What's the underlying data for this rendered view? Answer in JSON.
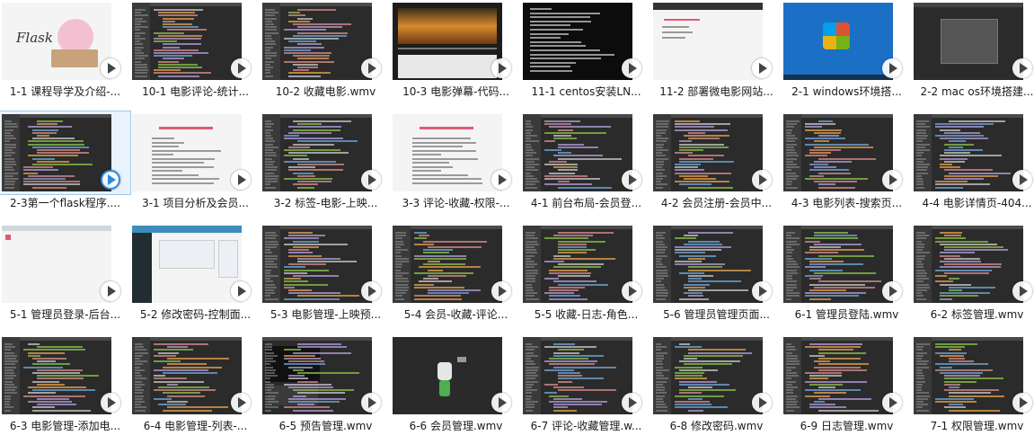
{
  "videos": [
    {
      "label": "1-1 课程导学及介绍-...",
      "kind": "flask",
      "logo": "Flask"
    },
    {
      "label": "10-1 电影评论-统计...",
      "kind": "editor"
    },
    {
      "label": "10-2 收藏电影.wmv",
      "kind": "editor"
    },
    {
      "label": "10-3 电影弹幕-代码...",
      "kind": "sunset"
    },
    {
      "label": "11-1 centos安装LN...",
      "kind": "terminal"
    },
    {
      "label": "11-2 部署微电影网站...",
      "kind": "dialog"
    },
    {
      "label": "2-1 windows环境搭...",
      "kind": "desktop"
    },
    {
      "label": "2-2 mac os环境搭建...",
      "kind": "dark"
    },
    {
      "label": "2-3第一个flask程序....",
      "kind": "editor",
      "selected": true
    },
    {
      "label": "3-1 项目分析及会员...",
      "kind": "doc"
    },
    {
      "label": "3-2 标签-电影-上映...",
      "kind": "editor"
    },
    {
      "label": "3-3 评论-收藏-权限-...",
      "kind": "doc"
    },
    {
      "label": "4-1 前台布局-会员登...",
      "kind": "editor"
    },
    {
      "label": "4-2 会员注册-会员中...",
      "kind": "editor"
    },
    {
      "label": "4-3 电影列表-搜索页...",
      "kind": "editor"
    },
    {
      "label": "4-4 电影详情页-404...",
      "kind": "editor"
    },
    {
      "label": "5-1 管理员登录-后台...",
      "kind": "white"
    },
    {
      "label": "5-2 修改密码-控制面...",
      "kind": "admin"
    },
    {
      "label": "5-3 电影管理-上映预...",
      "kind": "editor"
    },
    {
      "label": "5-4 会员-收藏-评论...",
      "kind": "editor"
    },
    {
      "label": "5-5 收藏-日志-角色...",
      "kind": "editor"
    },
    {
      "label": "5-6 管理员管理页面...",
      "kind": "editor"
    },
    {
      "label": "6-1 管理员登陆.wmv",
      "kind": "editor"
    },
    {
      "label": "6-2 标签管理.wmv",
      "kind": "editor"
    },
    {
      "label": "6-3 电影管理-添加电...",
      "kind": "editor"
    },
    {
      "label": "6-4 电影管理-列表-...",
      "kind": "editor"
    },
    {
      "label": "6-5 预告管理.wmv",
      "kind": "player"
    },
    {
      "label": "6-6 会员管理.wmv",
      "kind": "robot"
    },
    {
      "label": "6-7 评论-收藏管理.w...",
      "kind": "editor"
    },
    {
      "label": "6-8 修改密码.wmv",
      "kind": "editor"
    },
    {
      "label": "6-9 日志管理.wmv",
      "kind": "editor"
    },
    {
      "label": "7-1 权限管理.wmv",
      "kind": "editor"
    }
  ],
  "colors": {
    "play_selected": "#2a8be0",
    "selection_border": "#9cc8ef",
    "code_green": "#8bc34a",
    "code_orange": "#e6a24c",
    "code_blue": "#6fa8dc"
  },
  "icons": {
    "play": "play-icon"
  }
}
